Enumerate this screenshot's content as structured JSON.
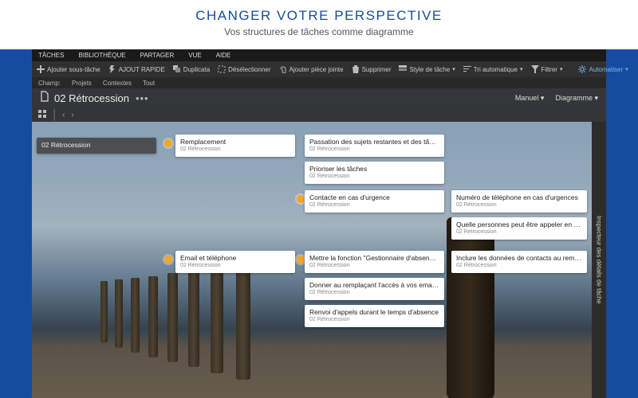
{
  "promo": {
    "title": "CHANGER VOTRE PERSPECTIVE",
    "subtitle": "Vos structures de tâches comme diagramme"
  },
  "menu": [
    "TÂCHES",
    "BIBLIOTHÈQUE",
    "PARTAGER",
    "VUE",
    "AIDE"
  ],
  "toolbar": {
    "add_subtask": "Ajouter sous-tâche",
    "quick_add": "AJOUT RAPIDE",
    "duplicate": "Duplicata",
    "deselect": "Désélectionner",
    "attach": "Ajouter pièce jointe",
    "delete": "Supprimer",
    "style": "Style de tâche",
    "sort": "Tri automatique",
    "filter": "Filtrer",
    "automate": "Automatiser"
  },
  "crumbs": {
    "label": "Champ:",
    "items": [
      "Projets",
      "Contextes",
      "Tout"
    ]
  },
  "doc": {
    "title": "02 Rétrocession"
  },
  "titlerow": {
    "mode": "Manuel",
    "view": "Diagramme"
  },
  "inspector": "Inspecteur des détails de tâche",
  "project_label": "02 Rétrocession",
  "cards": {
    "root": "02 Rétrocession",
    "remplacement": "Remplacement",
    "passation": "Passation des sujets restantes et des tâches",
    "prioriser": "Prioriser les tâches",
    "contact_urg": "Contacte en cas d'urgence",
    "num_urg": "Numéro de téléphone en cas d'urgences",
    "quelle": "Quelle personnes peut être appeler en cas …",
    "email_tel": "Email et téléphone",
    "mettre": "Mettre la fonction \"Gestionnaire d'absence d…",
    "inclure": "Inclure les données de contacts au remplaçant",
    "donner": "Donner au remplaçant l'accès à vos emails …",
    "renvoi": "Renvoi d'appels durant le temps d'absence"
  }
}
